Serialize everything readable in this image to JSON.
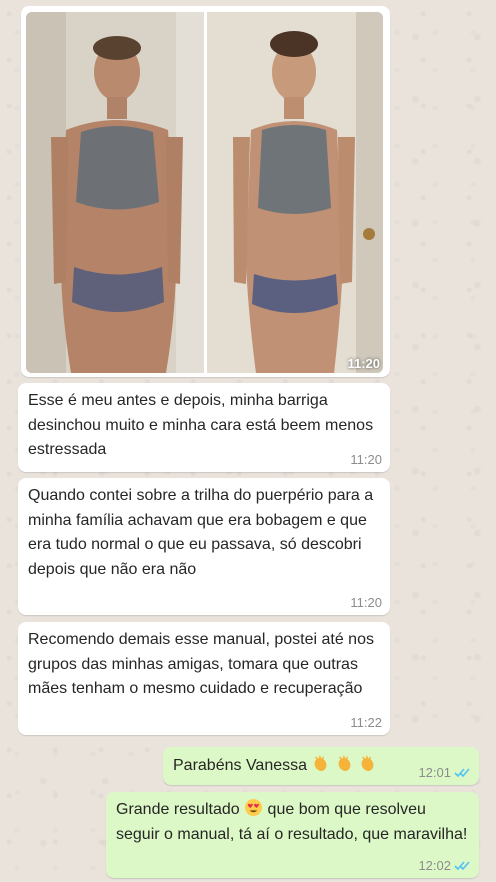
{
  "chat": {
    "photo_message": {
      "image_alt": "Before and after comparison photo",
      "time": "11:20"
    },
    "messages": [
      {
        "direction": "incoming",
        "text": "Esse é meu antes e depois, minha barriga desinchou muito e minha cara está beem menos estressada",
        "time": "11:20"
      },
      {
        "direction": "incoming",
        "text": "Quando contei sobre a trilha do puerpério para a minha família achavam que era bobagem e que era tudo normal o que eu passava, só descobri depois que não era não",
        "time": "11:20"
      },
      {
        "direction": "incoming",
        "text": "Recomendo demais esse manual, postei até nos grupos das minhas amigas, tomara que outras mães tenham o mesmo cuidado e recuperação",
        "time": "11:22"
      },
      {
        "direction": "outgoing",
        "text": "Parabéns Vanessa",
        "emojis": [
          "clapping-hands",
          "clapping-hands",
          "clapping-hands"
        ],
        "time": "12:01",
        "status": "read"
      },
      {
        "direction": "outgoing",
        "text_before_emoji": "Grande resultado",
        "emoji": "heart-eyes",
        "text_after_emoji": "que bom que resolveu seguir o manual, tá aí o resultado, que maravilha!",
        "time": "12:02",
        "status": "read"
      }
    ]
  },
  "colors": {
    "background": "#e9e3dc",
    "incoming_bubble": "#ffffff",
    "outgoing_bubble": "#dcf8c6",
    "read_ticks": "#4fc3f7",
    "timestamp": "#8c8c8c"
  }
}
